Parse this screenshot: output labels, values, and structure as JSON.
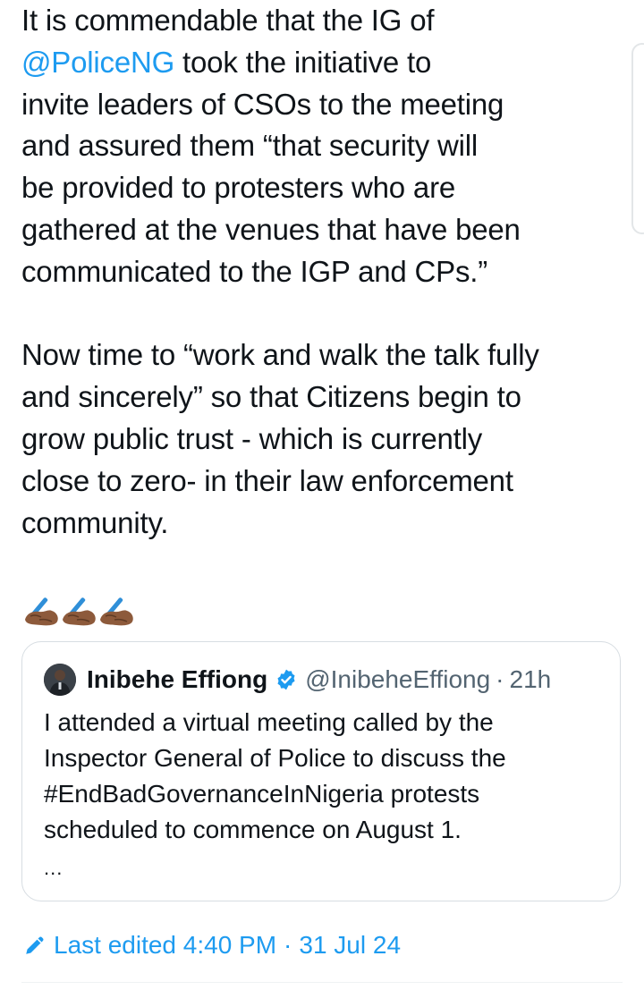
{
  "tweet": {
    "lines_para1": {
      "l1": "It is commendable that the IG of",
      "mention": "@PoliceNG",
      "l2_rest": " took the initiative to",
      "l3": "invite leaders of CSOs to the meeting",
      "l4": "and assured them “that security will",
      "l5": "be provided to protesters who are",
      "l6": "gathered at the venues that have been",
      "l7": "communicated to the IGP and CPs.”"
    },
    "lines_para2": {
      "l1": "Now time to “work and walk the talk fully",
      "l2": "and sincerely” so that Citizens begin to",
      "l3": "grow public trust - which is currently",
      "l4": "close to zero-  in their law enforcement",
      "l5": "community."
    },
    "emojis": [
      "writing-hand-icon",
      "writing-hand-icon",
      "writing-hand-icon"
    ]
  },
  "quote": {
    "name": "Inibehe Effiong",
    "handle": "@InibeheEffiong",
    "separator": "·",
    "time": "21h",
    "lines": {
      "l1": "I attended a virtual meeting called by the",
      "l2": "Inspector General of Police to discuss the",
      "l3": "#EndBadGovernanceInNigeria protests",
      "l4": "scheduled to commence on August 1."
    },
    "more": "..."
  },
  "edited": {
    "label": "Last edited 4:40 PM",
    "separator": "·",
    "date": "31 Jul 24"
  },
  "colors": {
    "accent": "#1d9bf0",
    "text": "#0f1419",
    "muted": "#536471",
    "border": "#d7dde2"
  }
}
